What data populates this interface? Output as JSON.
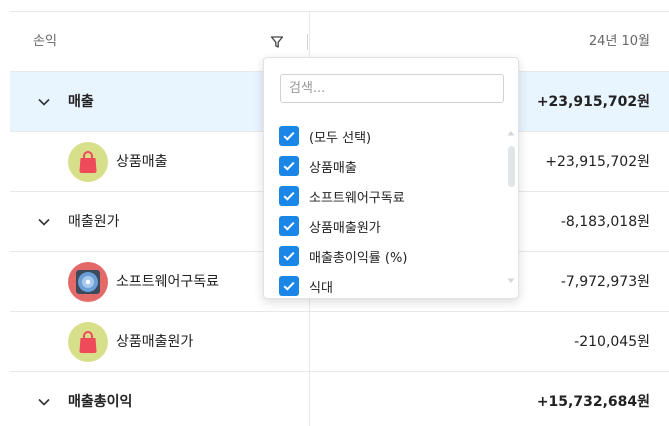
{
  "table": {
    "header": {
      "column_label": "손익",
      "period": "24년 10월"
    },
    "rows": [
      {
        "label": "매출",
        "value": "+23,915,702원"
      },
      {
        "label": "상품매출",
        "value": "+23,915,702원"
      },
      {
        "label": "매출원가",
        "value": "-8,183,018원"
      },
      {
        "label": "소프트웨어구독료",
        "value": "-7,972,973원"
      },
      {
        "label": "상품매출원가",
        "value": "-210,045원"
      },
      {
        "label": "매출총이익",
        "value": "+15,732,684원"
      }
    ]
  },
  "filter_dropdown": {
    "search_placeholder": "검색...",
    "options": [
      {
        "label": "(모두 선택)",
        "checked": true
      },
      {
        "label": "상품매출",
        "checked": true
      },
      {
        "label": "소프트웨어구독료",
        "checked": true
      },
      {
        "label": "상품매출원가",
        "checked": true
      },
      {
        "label": "매출총이익률 (%)",
        "checked": true
      },
      {
        "label": "식대",
        "checked": true
      }
    ]
  },
  "icons": {
    "filter": "filter-funnel-icon",
    "expand": "chevron-down-icon",
    "shopping_bag": "shopping-bag-icon",
    "disc": "disc-icon",
    "checkbox": "checkmark-icon"
  },
  "colors": {
    "selected_row": "#e8f4fe",
    "accent": "#1a86e8",
    "bag_avatar_bg": "#d8df8a",
    "bag_color": "#ee4a5a",
    "disc_avatar_bg": "#e46a6a",
    "disc_color": "#6a9fd8"
  }
}
